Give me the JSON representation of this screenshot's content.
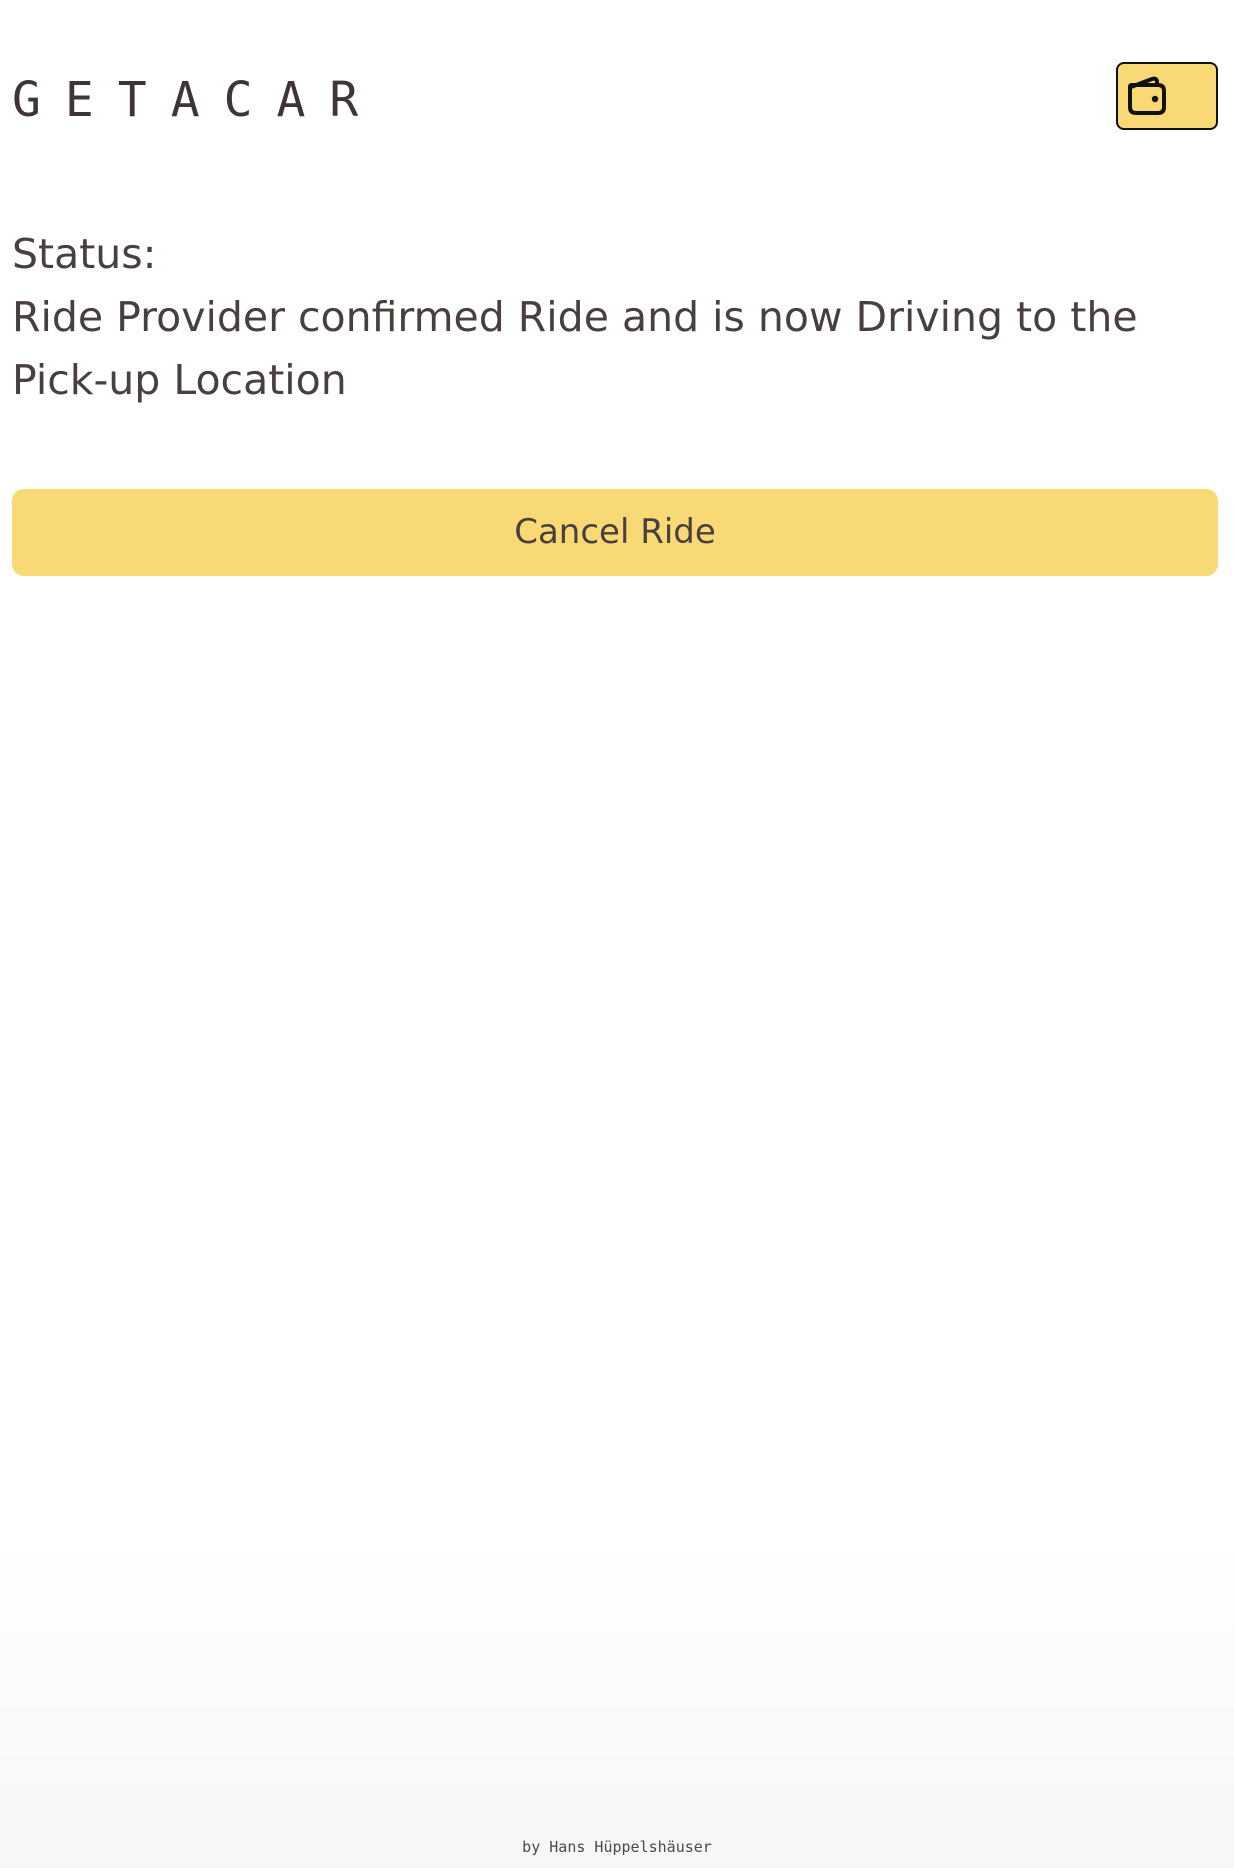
{
  "app": {
    "logo_text": "GETACAR"
  },
  "header": {
    "wallet_button": {
      "icon": "wallet-icon"
    }
  },
  "status": {
    "label": "Status:",
    "text": "Ride Provider confirmed Ride and is now Driving to the Pick-up Location"
  },
  "actions": {
    "cancel_label": "Cancel Ride"
  },
  "footer": {
    "credit": "by Hans Hüppelshäuser"
  },
  "colors": {
    "accent": "#F9D976",
    "text": "#4A3F3F",
    "background": "#FFFFFF"
  }
}
